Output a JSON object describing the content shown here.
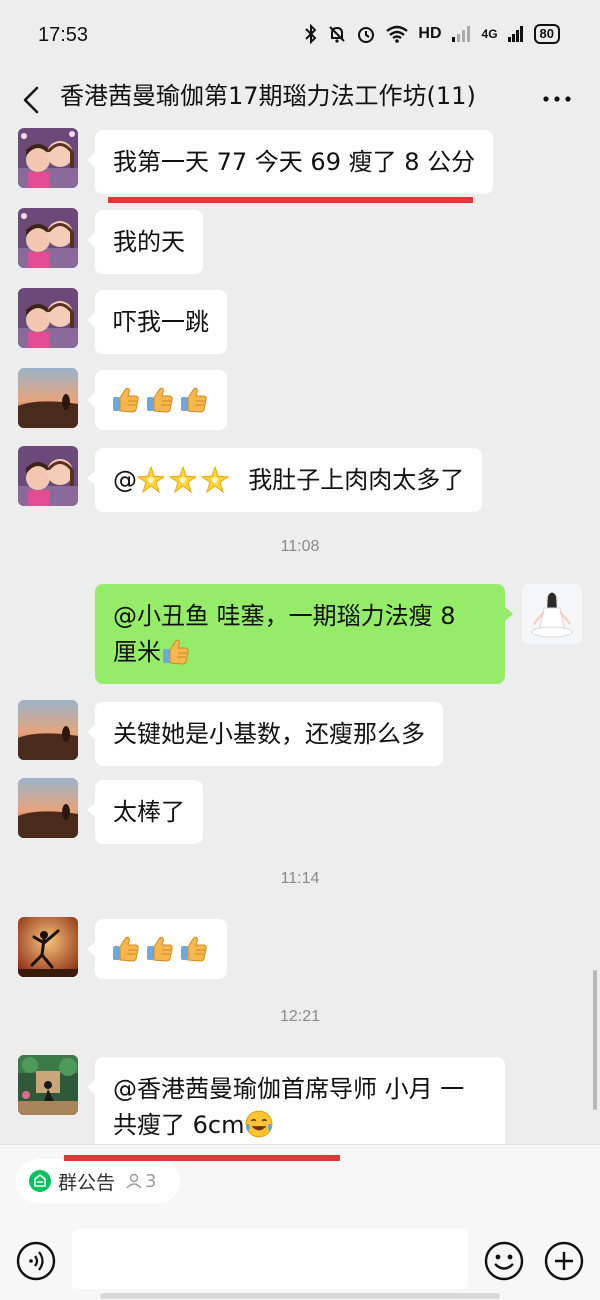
{
  "status_bar": {
    "time": "17:53",
    "network": "HD",
    "signal_label": "4G",
    "battery": "80"
  },
  "header": {
    "title": "香港茜曼瑜伽第17期瑙力法工作坊(11)"
  },
  "messages": [
    {
      "type": "text",
      "sender": "left",
      "avatar": "avatar-woman-child",
      "text": "我第一天 77 今天 69 瘦了 8 公分"
    },
    {
      "type": "text",
      "sender": "left",
      "avatar": "avatar-woman-child",
      "text": "我的天"
    },
    {
      "type": "text",
      "sender": "left",
      "avatar": "avatar-woman-child",
      "text": "吓我一跳"
    },
    {
      "type": "emoji",
      "sender": "left",
      "avatar": "avatar-sunset",
      "emojis": [
        "thumbs-up",
        "thumbs-up",
        "thumbs-up"
      ]
    },
    {
      "type": "text",
      "sender": "left",
      "avatar": "avatar-woman-child",
      "prefix": "@",
      "emojis": [
        "sparkle-star",
        "sparkle-star",
        "sparkle-star"
      ],
      "text": "我肚子上肉肉太多了"
    },
    {
      "type": "timestamp",
      "text": "11:08"
    },
    {
      "type": "text",
      "sender": "self",
      "avatar": "avatar-yoga-white",
      "line1": "@小丑鱼  哇塞，一期瑙力法瘦 8",
      "line2": "厘米"
    },
    {
      "type": "text",
      "sender": "left",
      "avatar": "avatar-sunset",
      "text": "关键她是小基数，还瘦那么多"
    },
    {
      "type": "text",
      "sender": "left",
      "avatar": "avatar-sunset",
      "text": "太棒了"
    },
    {
      "type": "timestamp",
      "text": "11:14"
    },
    {
      "type": "emoji",
      "sender": "left",
      "avatar": "avatar-dancer",
      "emojis": [
        "thumbs-up",
        "thumbs-up",
        "thumbs-up"
      ]
    },
    {
      "type": "timestamp",
      "text": "12:21"
    },
    {
      "type": "text",
      "sender": "left",
      "avatar": "avatar-yoga-studio",
      "line1": "@香港茜曼瑜伽首席导师  小月  一",
      "line2": "共瘦了 6cm"
    }
  ],
  "bottom": {
    "notice_label": "群公告",
    "member_count": "3",
    "input_placeholder": ""
  },
  "colors": {
    "background": "#ededed",
    "self_bubble": "#95ec69",
    "highlight_line": "#e8343b",
    "notice_icon": "#07c160"
  }
}
